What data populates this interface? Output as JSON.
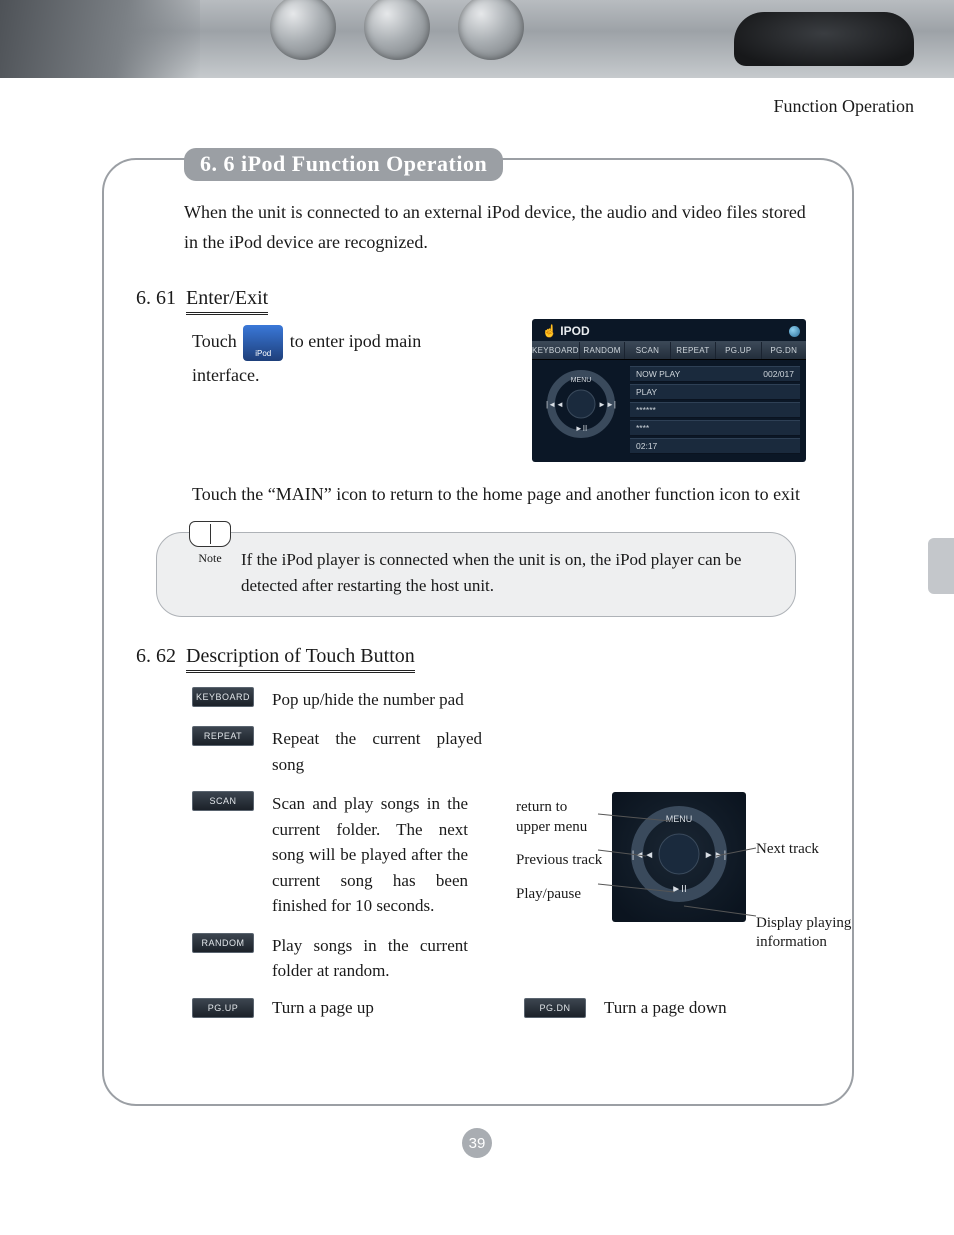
{
  "header": "Function  Operation",
  "title": "6. 6 iPod  Function  Operation",
  "intro": "When the unit is connected to an external iPod device, the audio and video files stored in the iPod device are recognized.",
  "section1": {
    "num": "6. 61",
    "title": "Enter/Exit",
    "touch_prefix": "Touch",
    "touch_suffix": "to enter ipod main interface.",
    "exit": "Touch the “MAIN” icon to return to the home page and another function icon to exit"
  },
  "ipod_screen": {
    "title": "IPOD",
    "tabs": [
      "KEYBOARD",
      "RANDOM",
      "SCAN",
      "REPEAT",
      "PG.UP",
      "PG.DN"
    ],
    "rows": [
      {
        "left": "NOW PLAY",
        "right": "002/017"
      },
      {
        "left": "PLAY",
        "right": ""
      },
      {
        "left": "******",
        "right": ""
      },
      {
        "left": "****",
        "right": ""
      },
      {
        "left": "02:17",
        "right": ""
      }
    ],
    "wheel": {
      "menu": "MENU",
      "prev": "|◄◄",
      "next": "►►|",
      "play": "►II"
    }
  },
  "note_label": "Note",
  "note_text": "If the iPod player is connected when the unit is on, the iPod player can be detected after restarting  the host unit.",
  "section2": {
    "num": "6. 62",
    "title": "Description of Touch Button",
    "items": [
      {
        "btn": "KEYBOARD",
        "desc": "Pop up/hide the number pad"
      },
      {
        "btn": "REPEAT",
        "desc": "Repeat the current played song"
      },
      {
        "btn": "SCAN",
        "desc": "Scan and play songs in the current folder. The next song will be played after the current song has been finished for 10 seconds."
      },
      {
        "btn": "RANDOM",
        "desc": "Play songs in the current folder at random."
      },
      {
        "btn": "PG.UP",
        "desc": "Turn a page up"
      },
      {
        "btn": "PG.DN",
        "desc": "Turn a page down"
      }
    ],
    "wheel_labels": {
      "return": "return to upper menu",
      "prev": "Previous track",
      "play": "Play/pause",
      "next": "Next track",
      "display": "Display playing information"
    }
  },
  "page_number": "39"
}
